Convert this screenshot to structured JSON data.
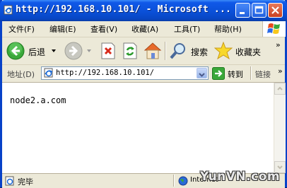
{
  "window": {
    "title": "http://192.168.10.101/ - Microsoft ...",
    "accent_color": "#0a50d8"
  },
  "menu": {
    "items": [
      "文件(F)",
      "编辑(E)",
      "查看(V)",
      "收藏(A)",
      "工具(T)",
      "帮助(H)"
    ]
  },
  "toolbar": {
    "back_label": "后退",
    "search_label": "搜索",
    "favorites_label": "收藏夹",
    "overflow": "»"
  },
  "address": {
    "label": "地址(D)",
    "value": "http://192.168.10.101/",
    "go_label": "转到",
    "links_label": "链接",
    "overflow": "»"
  },
  "content": {
    "text": "node2.a.com"
  },
  "status": {
    "text": "完毕",
    "zone": "Internet"
  },
  "watermark": {
    "text": "YunVN.com"
  },
  "icons": [
    "ie-page-icon",
    "minimize-icon",
    "maximize-icon",
    "close-icon",
    "windows-flag-icon",
    "back-icon",
    "forward-icon",
    "stop-icon",
    "refresh-icon",
    "home-icon",
    "search-icon",
    "favorites-star-icon",
    "go-arrow-icon",
    "globe-icon"
  ]
}
